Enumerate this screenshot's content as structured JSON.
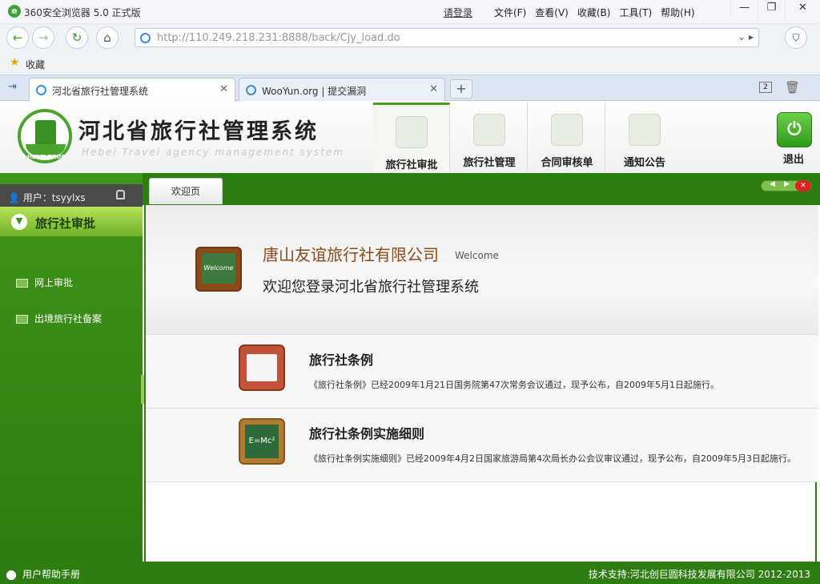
{
  "browser": {
    "title": "360安全浏览器 5.0 正式版",
    "login": "请登录",
    "menu": [
      "文件(F)",
      "查看(V)",
      "收藏(B)",
      "工具(T)",
      "帮助(H)"
    ],
    "url": "http://110.249.218.231:8888/back/Cjy_load.do",
    "bookmarks_label": "收藏",
    "tabs": [
      {
        "label": "河北省旅行社管理系统",
        "active": true
      },
      {
        "label": "WooYun.org | 提交漏洞",
        "active": false
      }
    ],
    "tab_count_badge": "2"
  },
  "app": {
    "title": "河北省旅行社管理系统",
    "subtitle": "Hebei Travel agency management system",
    "logo_text": "HEBEI TOUR",
    "nav": [
      {
        "label": "旅行社审批",
        "active": true
      },
      {
        "label": "旅行社管理",
        "active": false
      },
      {
        "label": "合同审核单",
        "active": false
      },
      {
        "label": "通知公告",
        "active": false
      }
    ],
    "exit_label": "退出"
  },
  "sidebar": {
    "user": "用户：tsyylxs",
    "section": "旅行社审批",
    "items": [
      "网上审批",
      "出境旅行社备案"
    ]
  },
  "main": {
    "tab": "欢迎页",
    "company": "唐山友谊旅行社有限公司",
    "welcome_word": "Welcome",
    "welcome_msg": "欢迎您登录河北省旅行社管理系统",
    "board_text": "Welcome",
    "notices": [
      {
        "title": "旅行社条例",
        "body": "《旅行社条例》已经2009年1月21日国务院第47次常务会议通过，现予公布，自2009年5月1日起施行。"
      },
      {
        "title": "旅行社条例实施细则",
        "body": "《旅行社条例实施细则》已经2009年4月2日国家旅游局第4次局长办公会议审议通过，现予公布，自2009年5月3日起施行。"
      }
    ],
    "chalk_text": "E=Mc²"
  },
  "status": {
    "help": "用户帮助手册",
    "credit": "技术支持:河北创巨圆科技发展有限公司 2012-2013"
  },
  "colors": {
    "brand_green": "#2d7d10",
    "accent_light": "#b7e35a",
    "company_brown": "#8b4a1a"
  }
}
